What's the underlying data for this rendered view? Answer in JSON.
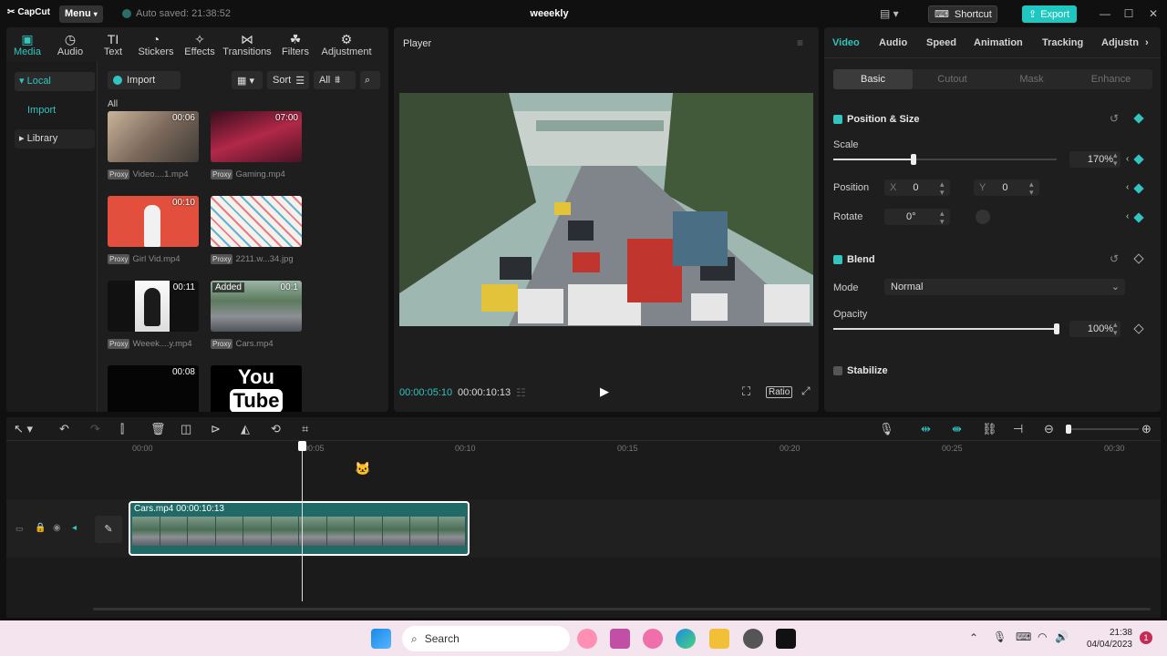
{
  "titlebar": {
    "app_name": "CapCut",
    "menu_label": "Menu",
    "autosave": "Auto saved: 21:38:52",
    "project": "weeekly",
    "shortcut_label": "Shortcut",
    "export_label": "Export"
  },
  "media_tabs": [
    {
      "label": "Media",
      "icon": "media-icon"
    },
    {
      "label": "Audio",
      "icon": "audio-icon"
    },
    {
      "label": "Text",
      "icon": "text-icon"
    },
    {
      "label": "Stickers",
      "icon": "stickers-icon"
    },
    {
      "label": "Effects",
      "icon": "effects-icon"
    },
    {
      "label": "Transitions",
      "icon": "transitions-icon"
    },
    {
      "label": "Filters",
      "icon": "filters-icon"
    },
    {
      "label": "Adjustment",
      "icon": "adjustment-icon"
    }
  ],
  "sidebar": {
    "local": "Local",
    "import": "Import",
    "library": "Library"
  },
  "media_toolbar": {
    "import": "Import",
    "sort": "Sort",
    "all": "All",
    "section": "All"
  },
  "media_items": [
    {
      "name": "Video....1.mp4",
      "duration": "00:06",
      "badge": "Proxy"
    },
    {
      "name": "Gaming.mp4",
      "duration": "07:00",
      "badge": "Proxy"
    },
    {
      "name": "Girl Vid.mp4",
      "duration": "00:10",
      "badge": "Proxy"
    },
    {
      "name": "2211.w...34.jpg",
      "duration": "",
      "badge": "Proxy"
    },
    {
      "name": "Weeek....y.mp4",
      "duration": "00:11",
      "badge": "Proxy"
    },
    {
      "name": "Cars.mp4",
      "duration": "00:1",
      "badge": "Proxy",
      "added": "Added"
    },
    {
      "name": "",
      "duration": "00:08",
      "badge": ""
    },
    {
      "name": "",
      "duration": "",
      "badge": "",
      "logo_text": [
        "You",
        "Tube"
      ]
    }
  ],
  "player": {
    "title": "Player",
    "current_time": "00:00:05:10",
    "total_time": "00:00:10:13",
    "ratio_label": "Ratio"
  },
  "props": {
    "tabs": [
      "Video",
      "Audio",
      "Speed",
      "Animation",
      "Tracking",
      "Adjustn"
    ],
    "subtabs": [
      "Basic",
      "Cutout",
      "Mask",
      "Enhance"
    ],
    "position_size": "Position & Size",
    "scale_label": "Scale",
    "scale_value": "170%",
    "scale_level": 0.36,
    "position_label": "Position",
    "x_label": "X",
    "x_value": "0",
    "y_label": "Y",
    "y_value": "0",
    "rotate_label": "Rotate",
    "rotate_value": "0°",
    "blend": "Blend",
    "mode_label": "Mode",
    "mode_value": "Normal",
    "opacity_label": "Opacity",
    "opacity_value": "100%",
    "opacity_level": 1.0,
    "stabilize": "Stabilize"
  },
  "timeline": {
    "ruler": [
      "00:00",
      "00:05",
      "00:10",
      "00:15",
      "00:20",
      "00:25",
      "00:30"
    ],
    "clip_name": "Cars.mp4",
    "clip_duration": "00:00:10:13"
  },
  "taskbar": {
    "search": "Search",
    "time": "21:38",
    "date": "04/04/2023",
    "notification_count": "1"
  },
  "colors": {
    "accent": "#33c4bd",
    "export": "#1ec8c0",
    "clip": "#1f6a67"
  }
}
